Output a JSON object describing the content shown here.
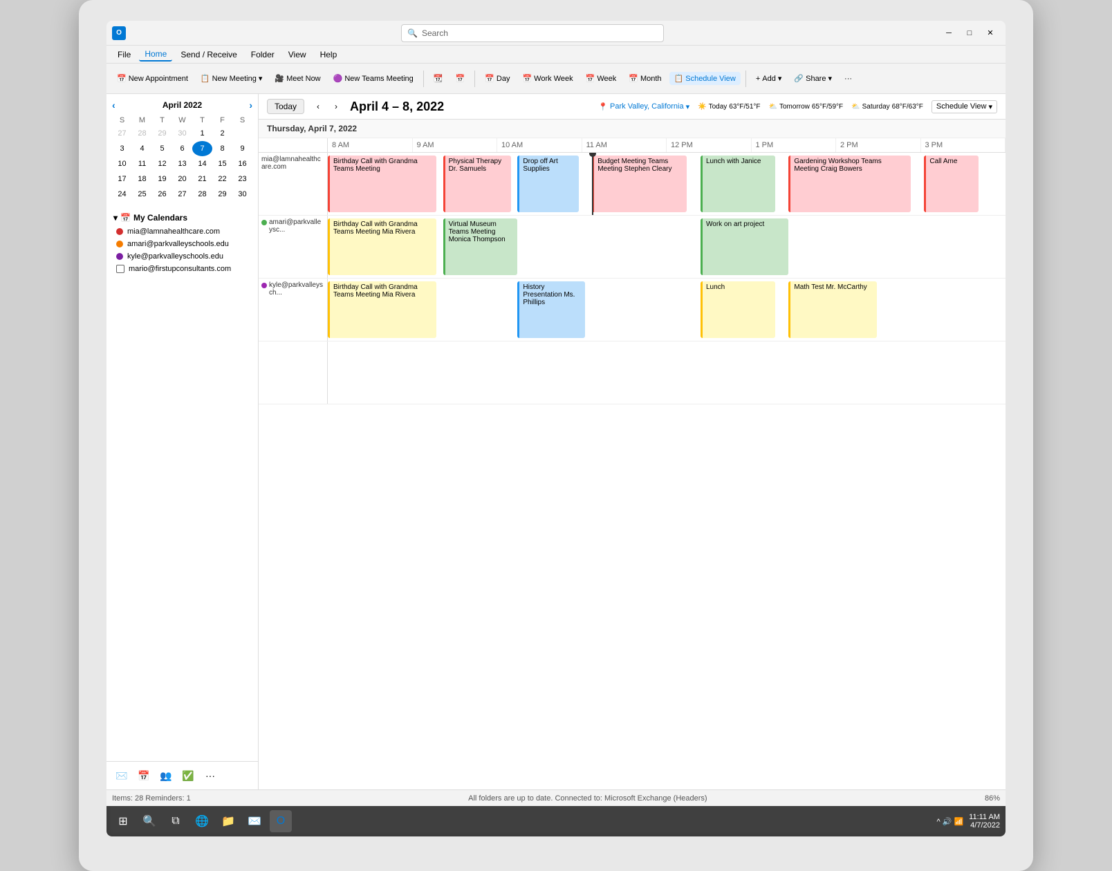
{
  "window": {
    "title": "Outlook",
    "search_placeholder": "Search"
  },
  "menu": {
    "items": [
      "File",
      "Home",
      "Send / Receive",
      "Folder",
      "View",
      "Help"
    ],
    "active": "Home"
  },
  "toolbar": {
    "buttons": [
      {
        "id": "new-appointment",
        "icon": "📅",
        "label": "New Appointment"
      },
      {
        "id": "new-meeting",
        "icon": "📋",
        "label": "New Meeting",
        "dropdown": true
      },
      {
        "id": "meet-now",
        "icon": "🎥",
        "label": "Meet Now"
      },
      {
        "id": "new-teams",
        "icon": "🟣",
        "label": "New Teams Meeting"
      },
      {
        "id": "open-cal",
        "icon": "📆",
        "label": ""
      },
      {
        "id": "open-cal2",
        "icon": "📅",
        "label": ""
      },
      {
        "id": "day",
        "icon": "📅",
        "label": "Day"
      },
      {
        "id": "work-week",
        "icon": "📅",
        "label": "Work Week"
      },
      {
        "id": "week",
        "icon": "📅",
        "label": "Week"
      },
      {
        "id": "month",
        "icon": "📅",
        "label": "Month"
      },
      {
        "id": "schedule-view",
        "icon": "📋",
        "label": "Schedule View",
        "active": true
      },
      {
        "id": "add",
        "icon": "+",
        "label": "Add",
        "dropdown": true
      },
      {
        "id": "share",
        "icon": "🔗",
        "label": "Share",
        "dropdown": true
      },
      {
        "id": "more",
        "icon": "•••",
        "label": ""
      }
    ]
  },
  "mini_calendar": {
    "title": "April 2022",
    "weekdays": [
      "S",
      "M",
      "T",
      "W",
      "T",
      "F",
      "S"
    ],
    "weeks": [
      [
        {
          "day": "27",
          "other": true
        },
        {
          "day": "28",
          "other": true
        },
        {
          "day": "29",
          "other": true
        },
        {
          "day": "30",
          "other": true
        },
        {
          "day": "1"
        },
        {
          "day": "2"
        }
      ],
      [
        {
          "day": "3"
        },
        {
          "day": "4"
        },
        {
          "day": "5"
        },
        {
          "day": "6"
        },
        {
          "day": "7",
          "today": true
        },
        {
          "day": "8"
        },
        {
          "day": "9"
        }
      ],
      [
        {
          "day": "10"
        },
        {
          "day": "11"
        },
        {
          "day": "12"
        },
        {
          "day": "13"
        },
        {
          "day": "14"
        },
        {
          "day": "15"
        },
        {
          "day": "16"
        }
      ],
      [
        {
          "day": "17"
        },
        {
          "day": "18"
        },
        {
          "day": "19"
        },
        {
          "day": "20"
        },
        {
          "day": "21"
        },
        {
          "day": "22"
        },
        {
          "day": "23"
        }
      ],
      [
        {
          "day": "24"
        },
        {
          "day": "25"
        },
        {
          "day": "26"
        },
        {
          "day": "27"
        },
        {
          "day": "28"
        },
        {
          "day": "29"
        },
        {
          "day": "30"
        }
      ]
    ]
  },
  "calendars": {
    "section_label": "My Calendars",
    "items": [
      {
        "email": "mia@lamnahealthcare.com",
        "color": "#d32f2f",
        "checked": true
      },
      {
        "email": "amari@parkvalleyschools.edu",
        "color": "#f57c00",
        "checked": true
      },
      {
        "email": "kyle@parkvalleyschools.edu",
        "color": "#7b1fa2",
        "checked": true
      },
      {
        "email": "mario@firstupconsultants.com",
        "color": "#333",
        "checked": false
      }
    ]
  },
  "cal_header": {
    "today_label": "Today",
    "date_range": "April 4 – 8, 2022",
    "location": "Park Valley, California",
    "weather": [
      {
        "day": "Today",
        "temp": "63°F/51°F",
        "icon": "☀️"
      },
      {
        "day": "Tomorrow",
        "temp": "65°F/59°F",
        "icon": "⛅"
      },
      {
        "day": "Saturday",
        "temp": "68°F/63°F",
        "icon": "⛅"
      }
    ],
    "view_label": "Schedule View"
  },
  "schedule": {
    "date_label": "Thursday, April 7, 2022",
    "time_labels": [
      "8 AM",
      "9 AM",
      "10 AM",
      "11 AM",
      "12 PM",
      "1 PM",
      "2 PM",
      "3 PM"
    ],
    "rows": [
      {
        "account": "mia@lamnahealthcare.com",
        "dot_color": null,
        "events": [
          {
            "label": "Birthday Call with Grandma Teams Meeting",
            "bg": "#ffcdd2",
            "left": "0%",
            "width": "16%"
          },
          {
            "label": "Physical Therapy Dr. Samuels",
            "bg": "#ffcdd2",
            "left": "17%",
            "width": "10%"
          },
          {
            "label": "Drop off Art Supplies",
            "bg": "#bbdefb",
            "left": "28%",
            "width": "9%"
          },
          {
            "label": "Budget Meeting Teams Meeting Stephen Cleary",
            "bg": "#ffcdd2",
            "left": "39%",
            "width": "14%"
          },
          {
            "label": "Lunch with Janice",
            "bg": "#c8e6c9",
            "left": "55%",
            "width": "11%"
          },
          {
            "label": "Gardening Workshop Teams Meeting Craig Bowers",
            "bg": "#ffcdd2",
            "left": "68%",
            "width": "18%"
          },
          {
            "label": "Call Ame",
            "bg": "#ffcdd2",
            "left": "88%",
            "width": "8%"
          }
        ]
      },
      {
        "account": "amari@parkvalleysc...",
        "dot_color": "#4caf50",
        "events": [
          {
            "label": "Birthday Call with Grandma Teams Meeting Mia Rivera",
            "bg": "#fff9c4",
            "left": "0%",
            "width": "16%"
          },
          {
            "label": "Virtual Museum Teams Meeting Monica Thompson",
            "bg": "#c8e6c9",
            "left": "17%",
            "width": "11%"
          },
          {
            "label": "Work on art project",
            "bg": "#c8e6c9",
            "left": "55%",
            "width": "13%"
          }
        ]
      },
      {
        "account": "kyle@parkvalleysch...",
        "dot_color": "#9c27b0",
        "events": [
          {
            "label": "Birthday Call with Grandma Teams Meeting Mia Rivera",
            "bg": "#fff9c4",
            "left": "0%",
            "width": "16%"
          },
          {
            "label": "History Presentation Ms. Phillips",
            "bg": "#bbdefb",
            "left": "28%",
            "width": "10%"
          },
          {
            "label": "Lunch",
            "bg": "#fff9c4",
            "left": "55%",
            "width": "11%"
          },
          {
            "label": "Math Test Mr. McCarthy",
            "bg": "#fff9c4",
            "left": "68%",
            "width": "13%"
          }
        ]
      },
      {
        "account": "",
        "dot_color": null,
        "events": []
      }
    ]
  },
  "status_bar": {
    "left": "Items: 28   Reminders: 1",
    "center": "All folders are up to date.   Connected to: Microsoft Exchange (Headers)",
    "zoom": "86%"
  },
  "taskbar": {
    "time": "11:11 AM",
    "date": "4/7/2022"
  },
  "sidebar_nav": {
    "icons": [
      "✉️",
      "📅",
      "👥",
      "✅",
      "•••"
    ]
  }
}
